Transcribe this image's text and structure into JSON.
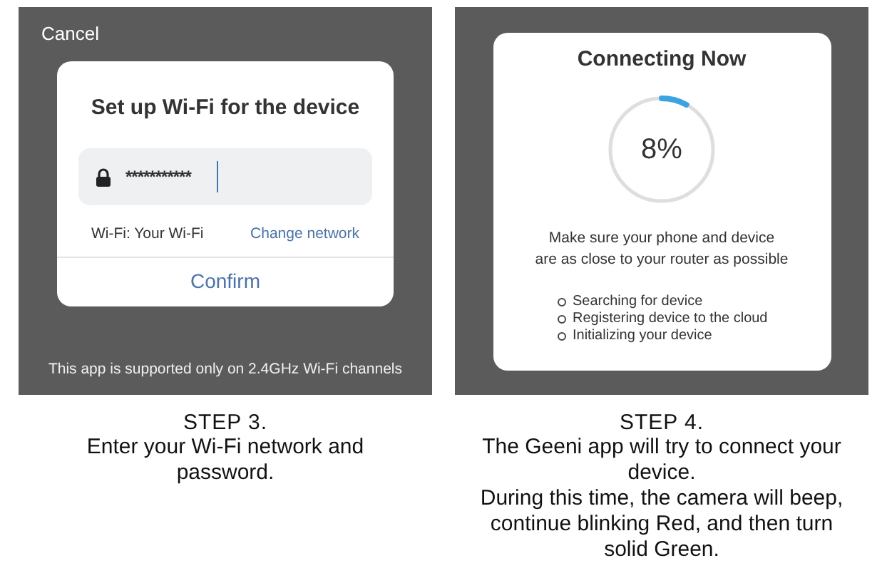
{
  "steps": [
    {
      "kind": "wifi",
      "screen": {
        "cancel": "Cancel",
        "title": "Set up Wi-Fi for the device",
        "password": "***********",
        "network_label": "Wi-Fi: Your Wi-Fi",
        "change_link": "Change network",
        "confirm": "Confirm",
        "footer": "This app is supported only on 2.4GHz Wi-Fi channels"
      },
      "heading": "STEP 3.",
      "paragraphs": [
        "Enter your Wi-Fi network and password."
      ]
    },
    {
      "kind": "connecting",
      "screen": {
        "title": "Connecting Now",
        "level": 0.08,
        "percent": "8%",
        "hint": [
          "Make sure your phone and device",
          "are as close to your router as possible"
        ],
        "tasks": [
          "Searching for device",
          "Registering device to the cloud",
          "Initializing your device"
        ]
      },
      "heading": "STEP 4.",
      "paragraphs": [
        "The Geeni app will try to connect your device.",
        "During this time, the camera will beep, continue blinking Red, and then turn solid Green."
      ]
    }
  ]
}
